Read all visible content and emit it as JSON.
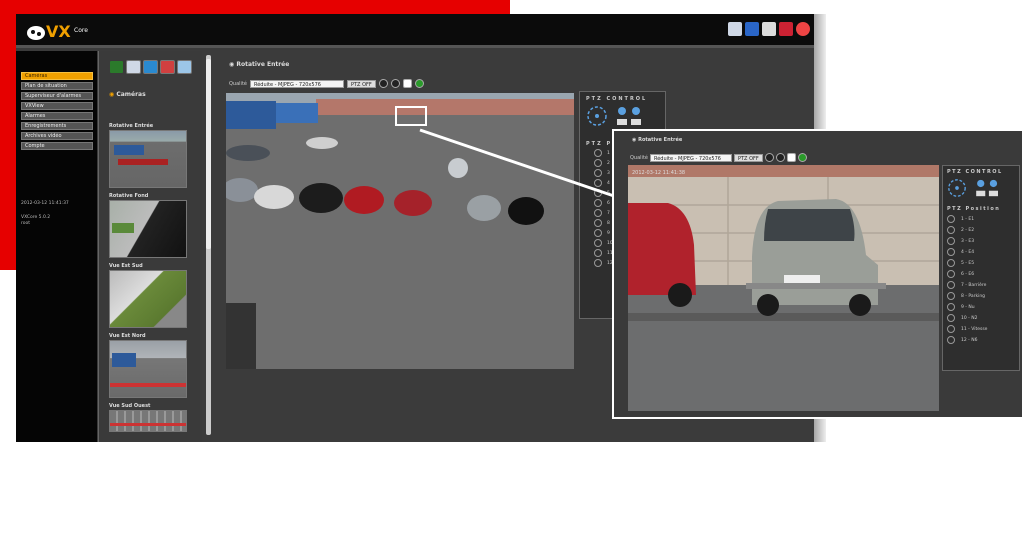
{
  "app": {
    "logo_text": "VX",
    "logo_sub": "Core"
  },
  "nav": {
    "items": [
      "Caméras",
      "Plan de situation",
      "Superviseur d'alarmes",
      "VXView",
      "Alarmes",
      "Enregistrements",
      "Archives vidéo",
      "Compte"
    ],
    "status_datetime": "2012-03-12  11:41:37",
    "status_version": "VXCore 5.0.2",
    "status_user": "root"
  },
  "cameras": {
    "header": "Caméras",
    "items": [
      "Rotative Entrée",
      "Rotative Fond",
      "Vue Est Sud",
      "Vue Est Nord",
      "Vue Sud Ouest"
    ]
  },
  "main": {
    "title": "Rotative Entrée",
    "quality_label": "Qualité",
    "quality_value": "Réduite - MJPEG - 720x576",
    "ptz_button": "PTZ OFF"
  },
  "ptz": {
    "control_title": "PTZ CONTROL",
    "position_title": "PTZ Position",
    "main_numbers": [
      "1",
      "2",
      "3",
      "4",
      "5",
      "6",
      "7",
      "8",
      "9",
      "10",
      "11",
      "12"
    ],
    "positions": [
      "1 - E1",
      "2 - E2",
      "3 - E3",
      "4 - E4",
      "5 - E5",
      "6 - E6",
      "7 - Barrière",
      "8 - Parking",
      "9 - Nu",
      "10 - N2",
      "11 - Vitesse",
      "12 - N6"
    ]
  },
  "zoom": {
    "title": "Rotative Entrée",
    "timestamp": "2012-03-12 11:41:38"
  },
  "colors": {
    "accent": "#f0a000",
    "brand_red": "#e60000"
  }
}
